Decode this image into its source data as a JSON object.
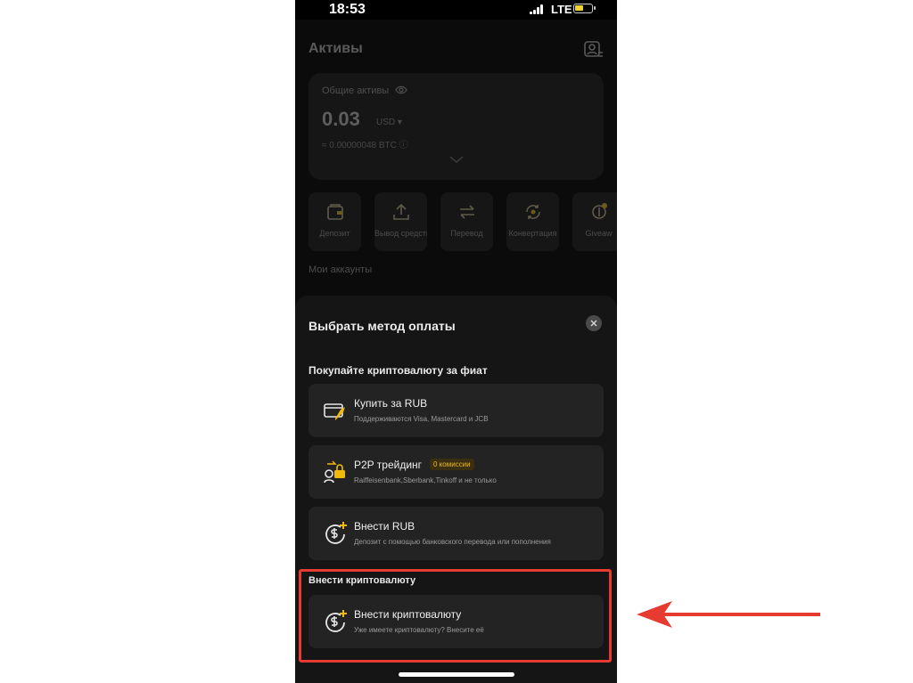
{
  "status": {
    "time": "18:53",
    "network": "LTE"
  },
  "assets": {
    "title": "Активы",
    "total_label": "Общие активы",
    "total_value": "0.03",
    "currency": "USD ▾",
    "btc_equiv": "≈ 0.00000048 BTC ⓘ",
    "actions": [
      {
        "label": "Депозит",
        "icon": "deposit-wallet-icon"
      },
      {
        "label": "Вывод средств",
        "icon": "upload-icon"
      },
      {
        "label": "Перевод",
        "icon": "transfer-arrows-icon"
      },
      {
        "label": "Конвертация",
        "icon": "convert-icon"
      },
      {
        "label": "Giveaw",
        "icon": "giveaway-icon"
      }
    ],
    "my_accounts": "Мои аккаунты"
  },
  "sheet": {
    "title": "Выбрать метод оплаты",
    "section_fiat": "Покупайте криптовалюту за фиат",
    "options": [
      {
        "title": "Купить за RUB",
        "subtitle": "Поддерживаются Visa, Mastercard и JCB",
        "icon": "card-rocket-icon"
      },
      {
        "title": "P2P трейдинг",
        "badge": "0 комиссии",
        "subtitle": "Raiffeisenbank,Sberbank,Tinkoff и не только",
        "icon": "p2p-exchange-icon"
      },
      {
        "title": "Внести RUB",
        "subtitle": "Депозит с помощью банковского перевода или пополнения",
        "icon": "dollar-plus-icon"
      }
    ],
    "section_crypto": "Внести криптовалюту",
    "crypto_option": {
      "title": "Внести криптовалюту",
      "subtitle": "Уже имеете криптовалюту? Внесите её",
      "icon": "dollar-plus-icon"
    }
  },
  "colors": {
    "accent": "#f0b90b",
    "highlight": "#e53b31",
    "arrow": "#e53b31"
  }
}
